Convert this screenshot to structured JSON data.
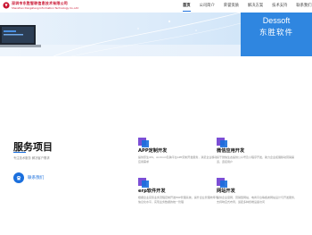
{
  "header": {
    "logo_cn": "深圳市东胜智联信息技术有限公司",
    "logo_en": "Shenzhen Dongsheng Information Technology Co.,Ltd"
  },
  "nav": {
    "items": [
      {
        "label": "首页",
        "active": true
      },
      {
        "label": "公司简介",
        "active": false
      },
      {
        "label": "荣誉资质",
        "active": false
      },
      {
        "label": "解决方案",
        "active": false
      },
      {
        "label": "技术支持",
        "active": false
      },
      {
        "label": "联系我们",
        "active": false
      }
    ]
  },
  "banner": {
    "brand_en": "Dessoft",
    "brand_cn": "东胜软件"
  },
  "services": {
    "title": "服务项目",
    "subtitle": "专注技术服务 解决客户需求",
    "contact_label": "联系我们",
    "cards": [
      {
        "icon": "app-icon",
        "title": "APP定制开发",
        "desc": "提供原生iOS、Android及跨平台APP定制开发服务，满足企业移动应用需求"
      },
      {
        "icon": "wechat-icon",
        "title": "微信应用开发",
        "desc": "基于微信生态提供公众号及小程序开发，助力企业拓展移动营销渠道，连接用户"
      },
      {
        "icon": "erp-icon",
        "title": "erp软件开发",
        "desc": "根据企业实际业务流程定制开发ERP管理系统，提升企业管理效率与信息化水平，实现业务数据的统一管理"
      },
      {
        "icon": "web-icon",
        "title": "网站开发",
        "desc": "提供企业官网、营销型网站、电商平台等各类网站设计与开发服务，支持响应式布局，适配多种终端设备访问"
      }
    ]
  },
  "colors": {
    "accent": "#1a6fdd",
    "brand_box": "#2f86e0",
    "logo_red": "#c8102e"
  }
}
